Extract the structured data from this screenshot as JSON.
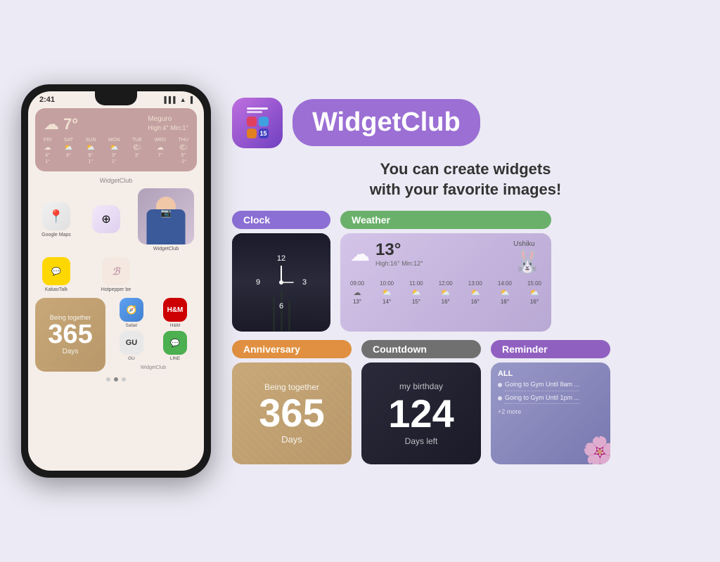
{
  "app": {
    "name": "WidgetClub",
    "tagline_line1": "You can create widgets",
    "tagline_line2": "with your favorite images!"
  },
  "phone": {
    "time": "2:41",
    "location": "Meguro",
    "temperature": "7°",
    "high": "High:4°",
    "min": "Min:1°",
    "weather_days": [
      {
        "label": "FRI",
        "icon": "☁",
        "temp1": "4°",
        "temp2": "1°"
      },
      {
        "label": "SAT",
        "icon": "⛅",
        "temp1": "6°",
        "temp2": ""
      },
      {
        "label": "SUN",
        "icon": "⛅",
        "temp1": "8°",
        "temp2": ""
      },
      {
        "label": "MON",
        "icon": "⛅",
        "temp1": "3°",
        "temp2": ""
      },
      {
        "label": "TUE",
        "icon": "🌤",
        "temp1": "3°",
        "temp2": ""
      },
      {
        "label": "WED",
        "icon": "☁",
        "temp1": "7°",
        "temp2": ""
      },
      {
        "label": "THU",
        "icon": "🌤",
        "temp1": "5°",
        "temp2": "-2°"
      }
    ],
    "apps": [
      {
        "name": "Google Maps",
        "icon": "maps"
      },
      {
        "name": "KakaoTalk",
        "icon": "kakao"
      },
      {
        "name": "Hotpepper be",
        "icon": "B"
      },
      {
        "name": "WidgetClub",
        "icon": "wc"
      }
    ],
    "anniversary": {
      "text1": "Being together",
      "number": "365",
      "text2": "Days"
    },
    "small_apps": [
      {
        "name": "Safari",
        "icon": "safari"
      },
      {
        "name": "H&M",
        "icon": "hm"
      },
      {
        "name": "GU",
        "icon": "gu"
      },
      {
        "name": "LINE",
        "icon": "line"
      }
    ],
    "widget_label": "WidgetClub"
  },
  "widgets": {
    "clock_label": "Clock",
    "weather_label": "Weather",
    "anniversary_label": "Anniversary",
    "countdown_label": "Countdown",
    "reminder_label": "Reminder"
  },
  "clock_widget": {
    "numbers": [
      "12",
      "3",
      "6",
      "9"
    ]
  },
  "weather_widget": {
    "location": "Ushiku",
    "temperature": "13°",
    "high": "High:16°",
    "min": "Min:12°",
    "hours": [
      {
        "time": "09:00",
        "icon": "☁",
        "temp": "13°"
      },
      {
        "time": "10:00",
        "icon": "⛅",
        "temp": "14°"
      },
      {
        "time": "11:00",
        "icon": "⛅",
        "temp": "15°"
      },
      {
        "time": "12:00",
        "icon": "⛅",
        "temp": "16°"
      },
      {
        "time": "13:00",
        "icon": "⛅",
        "temp": "16°"
      },
      {
        "time": "14:00",
        "icon": "⛅",
        "temp": "16°"
      },
      {
        "time": "15:00",
        "icon": "⛅",
        "temp": "16°"
      }
    ]
  },
  "anniversary_widget": {
    "text1": "Being together",
    "number": "365",
    "text2": "Days"
  },
  "countdown_widget": {
    "title": "my birthday",
    "number": "124",
    "subtitle": "Days left"
  },
  "reminder_widget": {
    "all_label": "ALL",
    "items": [
      "Going to Gym Until 8am ...",
      "Going to Gym Until 1pm ..."
    ],
    "more": "+2 more"
  }
}
